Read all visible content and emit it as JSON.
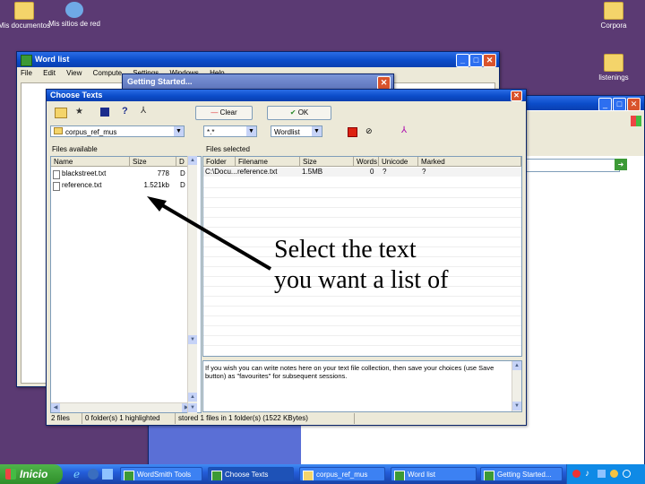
{
  "desktop": {
    "icons": [
      {
        "label": "Mis documentos"
      },
      {
        "label": "Mis sitios de red"
      },
      {
        "label": "Corpora"
      },
      {
        "label": "listenings"
      }
    ]
  },
  "windows": {
    "wordlist": {
      "title": "Word list",
      "menu": [
        "File",
        "Edit",
        "View",
        "Compute",
        "Settings",
        "Windows",
        "Help"
      ]
    },
    "getting_started": {
      "title": "Getting Started..."
    },
    "choose_texts": {
      "title": "Choose Texts",
      "buttons": {
        "clear": "Clear",
        "ok": "OK"
      },
      "folder_combo": "corpus_ref_mus",
      "filter_combo": "*.*",
      "type_combo": "Wordlist",
      "files_available_label": "Files available",
      "files_available_columns": [
        "Name",
        "Size",
        "D"
      ],
      "files_available_rows": [
        {
          "name": "blackstreet.txt",
          "size": "778",
          "d": "D"
        },
        {
          "name": "reference.txt",
          "size": "1.521kb",
          "d": "D"
        }
      ],
      "files_selected_label": "Files selected",
      "files_selected_columns": [
        "Folder",
        "Filename",
        "Size",
        "Words",
        "Unicode",
        "Marked"
      ],
      "files_selected_rows": [
        {
          "folder": "C:\\Docu...",
          "filename": "reference.txt",
          "size": "1.5MB",
          "words": "0",
          "unicode": "?",
          "marked": "?"
        }
      ],
      "notes": "If you wish you can write notes here on your text file collection, then save your choices (use Save button) as \"favourites\" for subsequent sessions.",
      "status": [
        "2 files",
        "0 folder(s) 1 highlighted",
        "stored 1 files in 1 folder(s) (1522 KBytes)"
      ]
    }
  },
  "callout_text": "Select the text you want a list of",
  "taskbar": {
    "start_label": "Inicio",
    "items": [
      "WordSmith Tools",
      "Choose Texts",
      "corpus_ref_mus",
      "Word list",
      "Getting Started..."
    ]
  }
}
